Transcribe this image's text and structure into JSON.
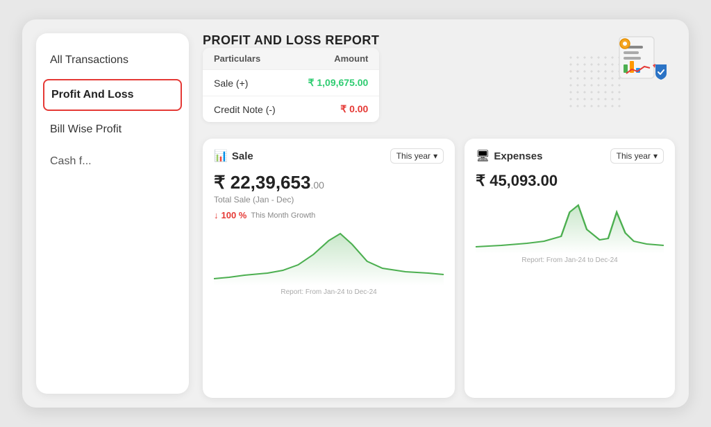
{
  "sidebar": {
    "items": [
      {
        "label": "All Transactions",
        "active": false
      },
      {
        "label": "Profit And Loss",
        "active": true
      },
      {
        "label": "Bill Wise Profit",
        "active": false
      },
      {
        "label": "Cash f...",
        "active": false
      }
    ]
  },
  "report": {
    "title": "PROFIT AND LOSS REPORT",
    "columns": {
      "particulars": "Particulars",
      "amount": "Amount"
    },
    "rows": [
      {
        "label": "Sale (+)",
        "amount": "₹ 1,09,675.00",
        "color": "green"
      },
      {
        "label": "Credit Note (-)",
        "amount": "₹ 0.00",
        "color": "red"
      }
    ]
  },
  "sale_card": {
    "title": "Sale",
    "year_label": "This year",
    "amount_main": "₹ 22,39,653",
    "amount_decimal": ".00",
    "subtitle": "Total Sale (Jan - Dec)",
    "growth_pct": "100 %",
    "growth_label": "This Month Growth",
    "chart_label": "Report: From Jan-24 to Dec-24"
  },
  "expense_card": {
    "title": "Expenses",
    "year_label": "This year",
    "amount_main": "₹ 45,093",
    "amount_decimal": ".00",
    "chart_label": "Report: From Jan-24 to Dec-24"
  }
}
